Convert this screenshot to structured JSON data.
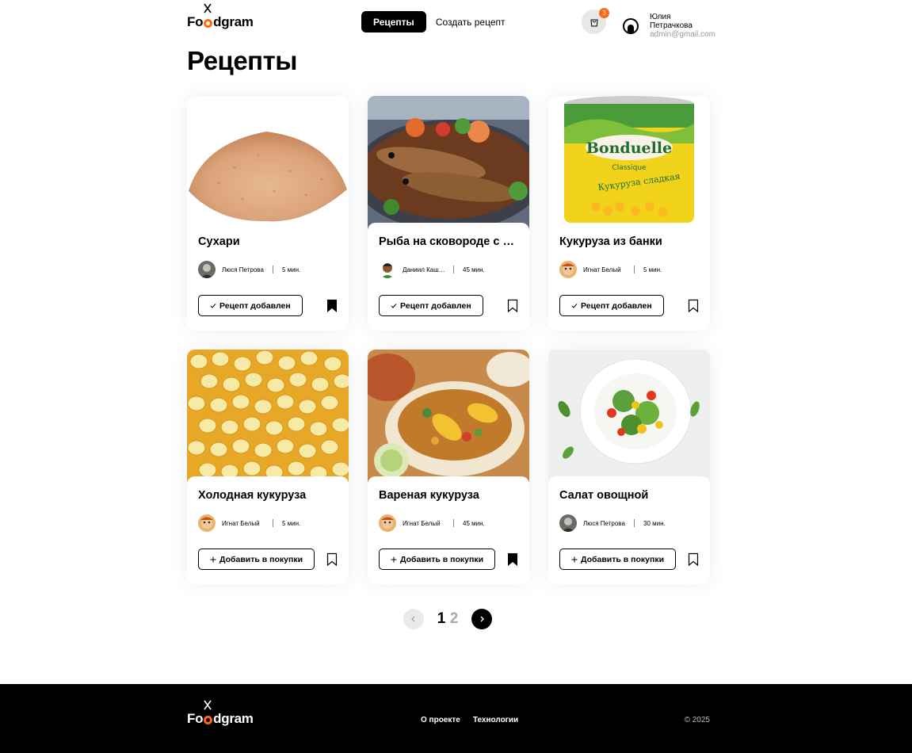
{
  "header": {
    "logo": {
      "pre": "Fo",
      "post": "dgram"
    },
    "nav": [
      {
        "label": "Рецепты",
        "active": true
      },
      {
        "label": "Создать рецепт",
        "active": false
      }
    ],
    "cart_count": "3",
    "user_name": "Юлия Петрачкова",
    "user_email": "admin@gmail.com"
  },
  "page_title": "Рецепты",
  "cards": [
    {
      "title": "Сухари",
      "author": "Люся Петрова",
      "time": "5 мин.",
      "action": "Рецепт добавлен",
      "action_icon": "check-icon",
      "bookmarked": true
    },
    {
      "title": "Рыба на сковороде с картошкой",
      "author": "Даниил Кашин",
      "time": "45 мин.",
      "action": "Рецепт добавлен",
      "action_icon": "check-icon",
      "bookmarked": false
    },
    {
      "title": "Кукуруза из банки",
      "author": "Игнат Белый",
      "time": "5 мин.",
      "action": "Рецепт добавлен",
      "action_icon": "check-icon",
      "bookmarked": false
    },
    {
      "title": "Холодная кукуруза",
      "author": "Игнат Белый",
      "time": "5 мин.",
      "action": "Добавить в покупки",
      "action_icon": "plus-icon",
      "bookmarked": false
    },
    {
      "title": "Вареная кукуруза",
      "author": "Игнат Белый",
      "time": "45 мин.",
      "action": "Добавить в покупки",
      "action_icon": "plus-icon",
      "bookmarked": true
    },
    {
      "title": "Салат овощной",
      "author": "Люся Петрова",
      "time": "30 мин.",
      "action": "Добавить в покупки",
      "action_icon": "plus-icon",
      "bookmarked": false
    }
  ],
  "can_labels": {
    "brand": "Bonduelle",
    "line": "Classique",
    "product": "Кукуруза сладкая"
  },
  "pagination": {
    "pages": [
      "1",
      "2"
    ],
    "current": "1"
  },
  "footer": {
    "links": [
      "О проекте",
      "Технологии"
    ],
    "copyright": "© 2025"
  },
  "colors": {
    "accent": "#fe6a13",
    "primary": "#000000"
  }
}
